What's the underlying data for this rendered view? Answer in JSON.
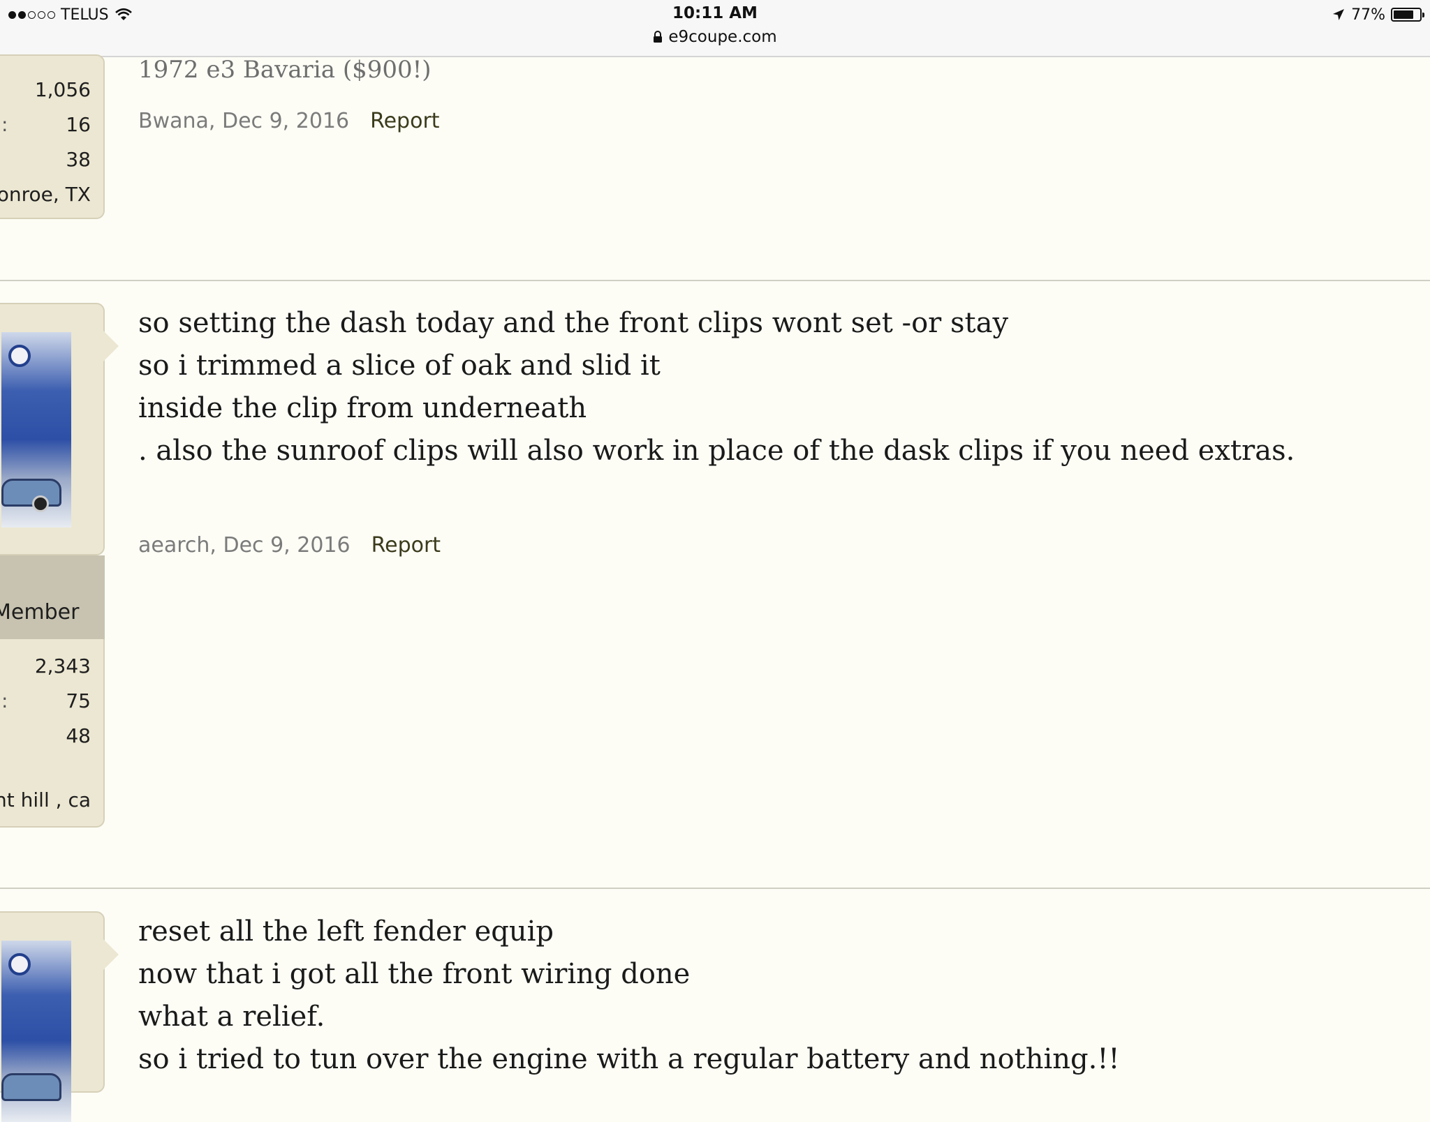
{
  "status_bar": {
    "carrier": "TELUS",
    "time": "10:11 AM",
    "url": "e9coupe.com",
    "battery": "77%",
    "signal_bars_filled": 2,
    "signal_bars_total": 5
  },
  "posts": [
    {
      "user_stats": [
        "1,056",
        "16",
        "38"
      ],
      "location": "Conroe, TX",
      "signature": "1972 e3 Bavaria ($900!)",
      "author": "Bwana",
      "date": "Dec 9, 2016",
      "report_label": "Report"
    },
    {
      "body_lines": [
        "so setting the dash today and the front clips wont set -or stay",
        "so i trimmed a slice of oak and slid it",
        "inside the clip from underneath",
        ". also the sunroof clips will also work in place of the dask clips if you need extras."
      ],
      "author": "aearch",
      "date": "Dec 9, 2016",
      "report_label": "Report",
      "user_rank": "Member",
      "user_stats": [
        "2,343",
        "75",
        "48"
      ],
      "location": "nt hill , ca"
    },
    {
      "body_lines": [
        "reset all the left fender equip",
        "now that i got all the front wiring done",
        "what a relief.",
        "so i tried to tun over the engine with a regular battery and nothing.!!"
      ]
    }
  ]
}
